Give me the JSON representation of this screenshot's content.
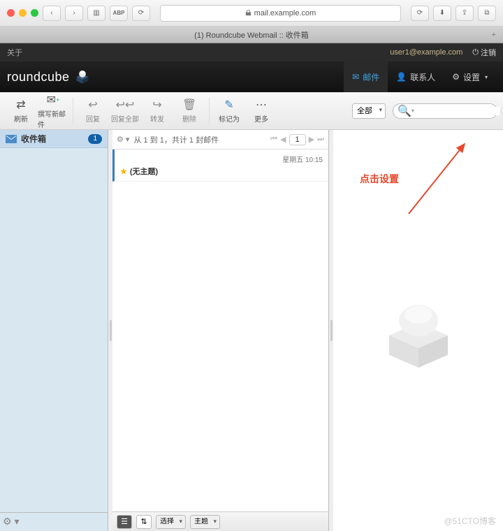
{
  "browser": {
    "url": "mail.example.com",
    "tab_title": "(1) Roundcube Webmail :: 收件箱"
  },
  "topbar": {
    "about": "关于",
    "user": "user1@example.com",
    "logout": "注销"
  },
  "brand": "roundcube",
  "nav": {
    "mail": "邮件",
    "contacts": "联系人",
    "settings": "设置"
  },
  "toolbar": {
    "refresh": "刷新",
    "compose": "撰写新邮件",
    "reply": "回复",
    "reply_all": "回复全部",
    "forward": "转发",
    "delete": "删除",
    "mark": "标记为",
    "more": "更多",
    "scope": "全部",
    "search_placeholder": ""
  },
  "folders": {
    "inbox": "收件箱",
    "inbox_count": "1"
  },
  "list": {
    "range": "从 1 到 1，共计 1 封邮件",
    "page": "1",
    "msg_time": "星期五 10:15",
    "msg_subject": "(无主题)"
  },
  "footer": {
    "select": "选择",
    "topic": "主题"
  },
  "annotation": "点击设置",
  "watermark": "@51CTO博客"
}
